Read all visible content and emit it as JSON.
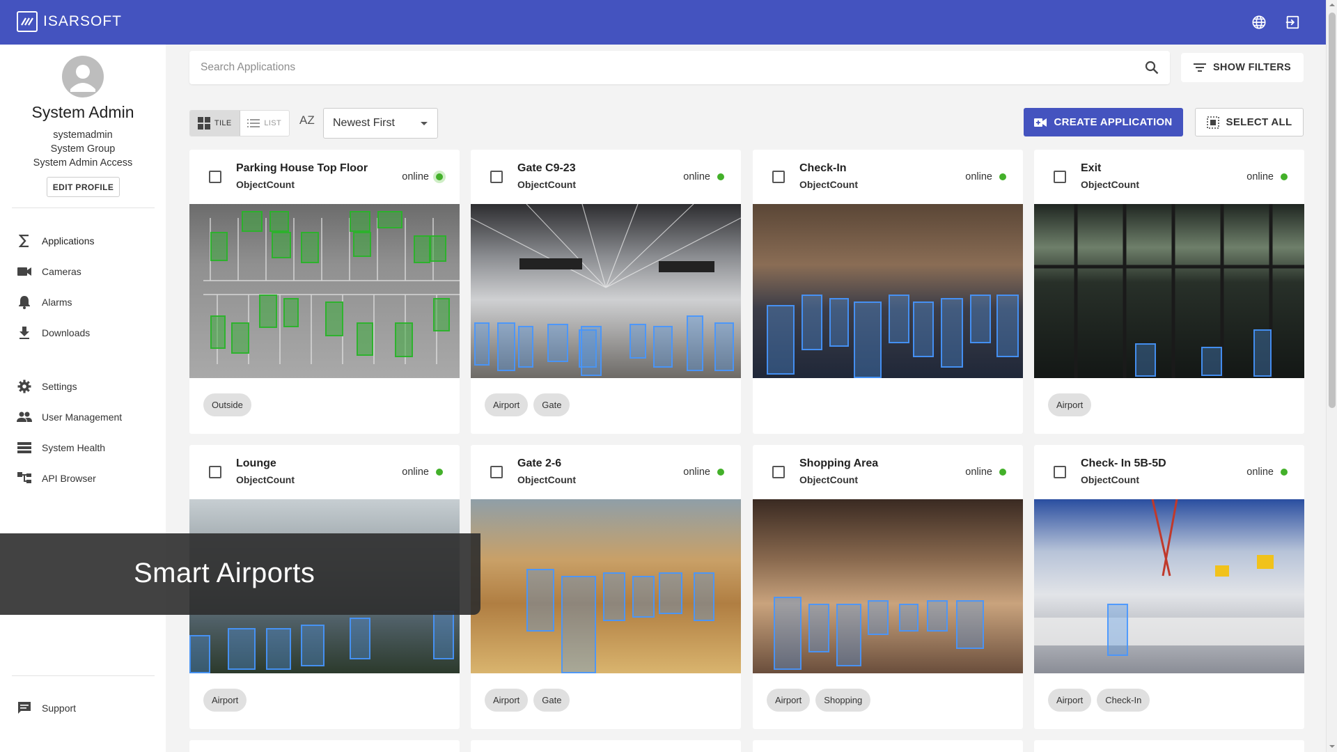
{
  "app": {
    "brand": "ISARSOFT",
    "accent": "#4453bf",
    "online_color": "#43b02a"
  },
  "header": {
    "icons": [
      "globe-icon",
      "logout-icon"
    ]
  },
  "profile": {
    "name": "System Admin",
    "username": "systemadmin",
    "group": "System Group",
    "access": "System Admin Access",
    "edit_label": "EDIT PROFILE"
  },
  "nav": {
    "applications": "Applications",
    "cameras": "Cameras",
    "alarms": "Alarms",
    "downloads": "Downloads",
    "settings": "Settings",
    "user_management": "User Management",
    "system_health": "System Health",
    "api_browser": "API Browser",
    "support": "Support"
  },
  "search": {
    "placeholder": "Search Applications",
    "value": ""
  },
  "toolbar": {
    "show_filters": "SHOW FILTERS",
    "tile": "TILE",
    "list": "LIST",
    "sort_icon": "AZ",
    "sort": "Newest First",
    "create": "CREATE APPLICATION",
    "select_all": "SELECT ALL"
  },
  "cards": [
    {
      "title": "Parking House Top Floor",
      "type": "ObjectCount",
      "status": "online",
      "tags": [
        "Outside"
      ]
    },
    {
      "title": "Gate C9-23",
      "type": "ObjectCount",
      "status": "online",
      "tags": [
        "Airport",
        "Gate"
      ]
    },
    {
      "title": "Check-In",
      "type": "ObjectCount",
      "status": "online",
      "tags": []
    },
    {
      "title": "Exit",
      "type": "ObjectCount",
      "status": "online",
      "tags": [
        "Airport"
      ]
    },
    {
      "title": "Lounge",
      "type": "ObjectCount",
      "status": "online",
      "tags": [
        "Airport"
      ]
    },
    {
      "title": "Gate 2-6",
      "type": "ObjectCount",
      "status": "online",
      "tags": [
        "Airport",
        "Gate"
      ]
    },
    {
      "title": "Shopping Area",
      "type": "ObjectCount",
      "status": "online",
      "tags": [
        "Airport",
        "Shopping"
      ]
    },
    {
      "title": "Check- In 5B-5D",
      "type": "ObjectCount",
      "status": "online",
      "tags": [
        "Airport",
        "Check-In"
      ]
    }
  ],
  "overlay": {
    "text": "Smart Airports"
  }
}
